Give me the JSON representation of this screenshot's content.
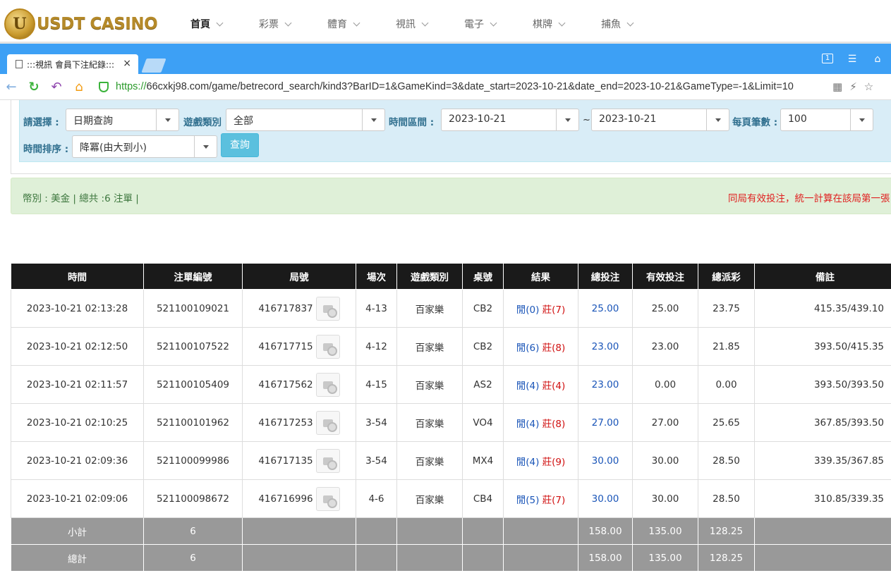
{
  "header": {
    "logo_letter": "U",
    "logo_text": "USDT CASINO",
    "nav": [
      "首頁",
      "彩票",
      "體育",
      "視訊",
      "電子",
      "棋牌",
      "捕魚"
    ]
  },
  "browser": {
    "tab_title": ":::視訊 會員下注紀錄:::",
    "tab_close": "×",
    "url_scheme": "https://",
    "url_rest": "66cxkj98.com/game/betrecord_search/kind3?BarID=1&GameKind=3&date_start=2023-10-21&date_end=2023-10-21&GameType=-1&Limit=10",
    "window_badge": "1"
  },
  "filters": {
    "select_label": "請選擇 :",
    "select_value": "日期查詢",
    "game_type_label": "遊戲類別",
    "game_type_value": "全部",
    "time_range_label": "時間區間 :",
    "date_start": "2023-10-21",
    "tilde": "~",
    "date_end": "2023-10-21",
    "per_page_label": "每頁筆數 :",
    "per_page_value": "100",
    "sort_label": "時間排序 :",
    "sort_value": "降冪(由大到小)",
    "query_button": "查詢"
  },
  "summary": {
    "left": "幣別 : 美金 | 總共 :6 注單 |",
    "right": "同局有效投注，統一計算在該局第一張"
  },
  "table": {
    "headers": [
      "時間",
      "注單編號",
      "局號",
      "場次",
      "遊戲類別",
      "桌號",
      "結果",
      "總投注",
      "有效投注",
      "總派彩",
      "備註"
    ],
    "rows": [
      {
        "time": "2023-10-21 02:13:28",
        "bet_id": "521100109021",
        "round": "416717837",
        "session": "4-13",
        "game": "百家樂",
        "table": "CB2",
        "player": "閒(0)",
        "banker": "莊(7)",
        "total_bet": "25.00",
        "valid_bet": "25.00",
        "payout": "23.75",
        "note": "415.35/439.10"
      },
      {
        "time": "2023-10-21 02:12:50",
        "bet_id": "521100107522",
        "round": "416717715",
        "session": "4-12",
        "game": "百家樂",
        "table": "CB2",
        "player": "閒(6)",
        "banker": "莊(8)",
        "total_bet": "23.00",
        "valid_bet": "23.00",
        "payout": "21.85",
        "note": "393.50/415.35"
      },
      {
        "time": "2023-10-21 02:11:57",
        "bet_id": "521100105409",
        "round": "416717562",
        "session": "4-15",
        "game": "百家樂",
        "table": "AS2",
        "player": "閒(4)",
        "banker": "莊(4)",
        "total_bet": "23.00",
        "valid_bet": "0.00",
        "payout": "0.00",
        "note": "393.50/393.50"
      },
      {
        "time": "2023-10-21 02:10:25",
        "bet_id": "521100101962",
        "round": "416717253",
        "session": "3-54",
        "game": "百家樂",
        "table": "VO4",
        "player": "閒(4)",
        "banker": "莊(8)",
        "total_bet": "27.00",
        "valid_bet": "27.00",
        "payout": "25.65",
        "note": "367.85/393.50"
      },
      {
        "time": "2023-10-21 02:09:36",
        "bet_id": "521100099986",
        "round": "416717135",
        "session": "3-54",
        "game": "百家樂",
        "table": "MX4",
        "player": "閒(4)",
        "banker": "莊(9)",
        "total_bet": "30.00",
        "valid_bet": "30.00",
        "payout": "28.50",
        "note": "339.35/367.85"
      },
      {
        "time": "2023-10-21 02:09:06",
        "bet_id": "521100098672",
        "round": "416716996",
        "session": "4-6",
        "game": "百家樂",
        "table": "CB4",
        "player": "閒(5)",
        "banker": "莊(7)",
        "total_bet": "30.00",
        "valid_bet": "30.00",
        "payout": "28.50",
        "note": "310.85/339.35"
      }
    ],
    "subtotal": {
      "label": "小計",
      "count": "6",
      "total_bet": "158.00",
      "valid_bet": "135.00",
      "payout": "128.25"
    },
    "total": {
      "label": "總計",
      "count": "6",
      "total_bet": "158.00",
      "valid_bet": "135.00",
      "payout": "128.25"
    }
  }
}
